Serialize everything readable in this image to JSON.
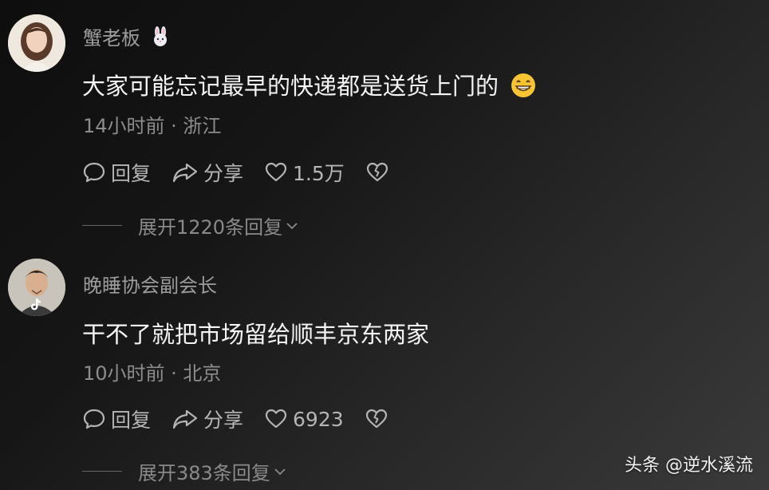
{
  "comments": [
    {
      "username": "蟹老板",
      "badge_icon": "rabbit-emoji-icon",
      "text": "大家可能忘记最早的快递都是送货上门的",
      "emoji": "😁",
      "meta": "14小时前 · 浙江",
      "reply_label": "回复",
      "share_label": "分享",
      "like_count": "1.5万",
      "expand_label": "展开1220条回复"
    },
    {
      "username": "晚睡协会副会长",
      "text": "干不了就把市场留给顺丰京东两家",
      "meta": "10小时前 · 北京",
      "reply_label": "回复",
      "share_label": "分享",
      "like_count": "6923",
      "expand_label": "展开383条回复"
    }
  ],
  "watermark": "头条 @逆水溪流"
}
